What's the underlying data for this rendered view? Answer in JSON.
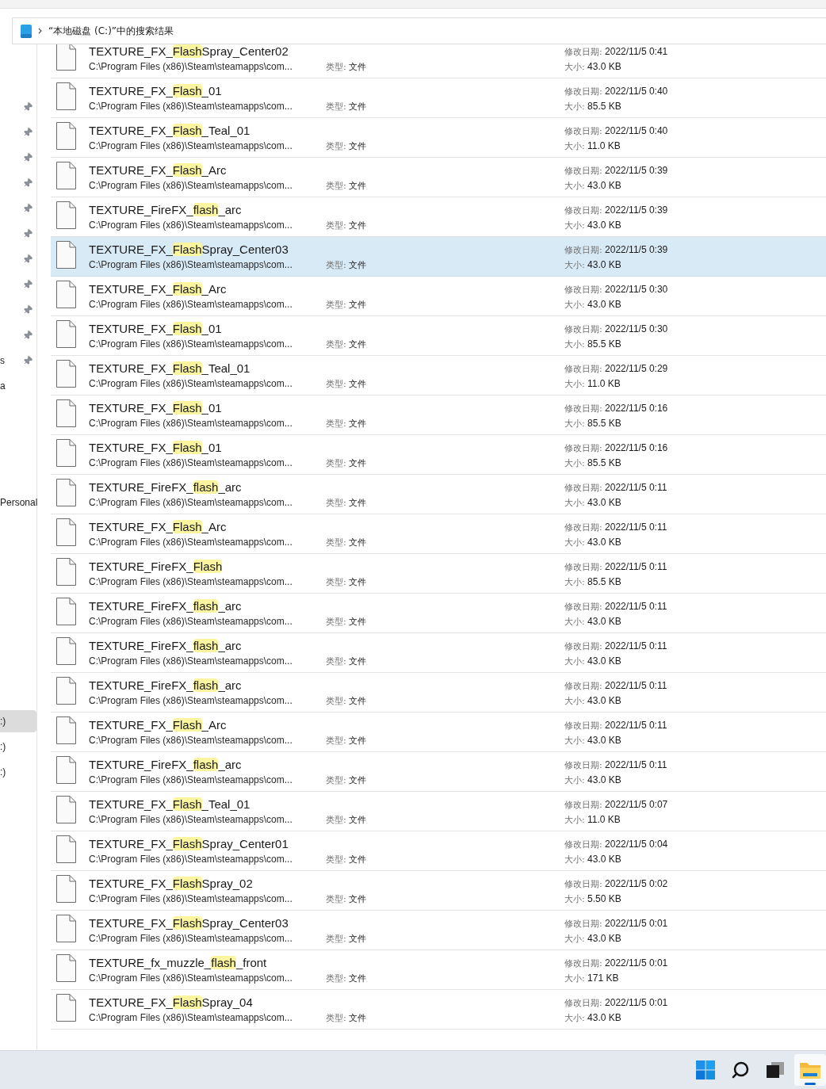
{
  "address_bar": {
    "path": "“本地磁盘 (C:)”中的搜索结果"
  },
  "sidebar": {
    "groups": [
      {
        "items": [
          {
            "pinned": true,
            "selected": false
          },
          {
            "pinned": true,
            "selected": false
          },
          {
            "pinned": true,
            "selected": false
          },
          {
            "pinned": true,
            "selected": false
          },
          {
            "pinned": true,
            "selected": false
          },
          {
            "pinned": true,
            "selected": false
          },
          {
            "pinned": true,
            "selected": false
          },
          {
            "pinned": true,
            "selected": false
          },
          {
            "pinned": true,
            "selected": false
          },
          {
            "pinned": true,
            "selected": false
          },
          {
            "label": "s",
            "pinned": true,
            "selected": false
          },
          {
            "label": "a",
            "pinned": false,
            "selected": false
          }
        ]
      },
      {
        "items": [
          {
            "label": "Personal",
            "pinned": false,
            "selected": false
          }
        ]
      },
      {
        "items": [
          {
            "label": ":)",
            "pinned": false,
            "selected": true
          },
          {
            "label": ":)",
            "pinned": false,
            "selected": false
          },
          {
            "label": ":)",
            "pinned": false,
            "selected": false
          }
        ]
      }
    ]
  },
  "results": [
    {
      "name": {
        "pre": "TEXTURE_FX_",
        "match": "Flash",
        "post": "Spray_Center02"
      },
      "path": "C:\\Program Files (x86)\\Steam\\steamapps\\com...",
      "type_label": "类型:",
      "type": "文件",
      "date_label": "修改日期:",
      "date": "2022/11/5 0:41",
      "size_label": "大小:",
      "size": "43.0 KB",
      "selected": false
    },
    {
      "name": {
        "pre": "TEXTURE_FX_",
        "match": "Flash",
        "post": "_01"
      },
      "path": "C:\\Program Files (x86)\\Steam\\steamapps\\com...",
      "type_label": "类型:",
      "type": "文件",
      "date_label": "修改日期:",
      "date": "2022/11/5 0:40",
      "size_label": "大小:",
      "size": "85.5 KB",
      "selected": false
    },
    {
      "name": {
        "pre": "TEXTURE_FX_",
        "match": "Flash",
        "post": "_Teal_01"
      },
      "path": "C:\\Program Files (x86)\\Steam\\steamapps\\com...",
      "type_label": "类型:",
      "type": "文件",
      "date_label": "修改日期:",
      "date": "2022/11/5 0:40",
      "size_label": "大小:",
      "size": "11.0 KB",
      "selected": false
    },
    {
      "name": {
        "pre": "TEXTURE_FX_",
        "match": "Flash",
        "post": "_Arc"
      },
      "path": "C:\\Program Files (x86)\\Steam\\steamapps\\com...",
      "type_label": "类型:",
      "type": "文件",
      "date_label": "修改日期:",
      "date": "2022/11/5 0:39",
      "size_label": "大小:",
      "size": "43.0 KB",
      "selected": false
    },
    {
      "name": {
        "pre": "TEXTURE_FireFX_",
        "match": "flash",
        "post": "_arc"
      },
      "path": "C:\\Program Files (x86)\\Steam\\steamapps\\com...",
      "type_label": "类型:",
      "type": "文件",
      "date_label": "修改日期:",
      "date": "2022/11/5 0:39",
      "size_label": "大小:",
      "size": "43.0 KB",
      "selected": false
    },
    {
      "name": {
        "pre": "TEXTURE_FX_",
        "match": "Flash",
        "post": "Spray_Center03"
      },
      "path": "C:\\Program Files (x86)\\Steam\\steamapps\\com...",
      "type_label": "类型:",
      "type": "文件",
      "date_label": "修改日期:",
      "date": "2022/11/5 0:39",
      "size_label": "大小:",
      "size": "43.0 KB",
      "selected": true
    },
    {
      "name": {
        "pre": "TEXTURE_FX_",
        "match": "Flash",
        "post": "_Arc"
      },
      "path": "C:\\Program Files (x86)\\Steam\\steamapps\\com...",
      "type_label": "类型:",
      "type": "文件",
      "date_label": "修改日期:",
      "date": "2022/11/5 0:30",
      "size_label": "大小:",
      "size": "43.0 KB",
      "selected": false
    },
    {
      "name": {
        "pre": "TEXTURE_FX_",
        "match": "Flash",
        "post": "_01"
      },
      "path": "C:\\Program Files (x86)\\Steam\\steamapps\\com...",
      "type_label": "类型:",
      "type": "文件",
      "date_label": "修改日期:",
      "date": "2022/11/5 0:30",
      "size_label": "大小:",
      "size": "85.5 KB",
      "selected": false
    },
    {
      "name": {
        "pre": "TEXTURE_FX_",
        "match": "Flash",
        "post": "_Teal_01"
      },
      "path": "C:\\Program Files (x86)\\Steam\\steamapps\\com...",
      "type_label": "类型:",
      "type": "文件",
      "date_label": "修改日期:",
      "date": "2022/11/5 0:29",
      "size_label": "大小:",
      "size": "11.0 KB",
      "selected": false
    },
    {
      "name": {
        "pre": "TEXTURE_FX_",
        "match": "Flash",
        "post": "_01"
      },
      "path": "C:\\Program Files (x86)\\Steam\\steamapps\\com...",
      "type_label": "类型:",
      "type": "文件",
      "date_label": "修改日期:",
      "date": "2022/11/5 0:16",
      "size_label": "大小:",
      "size": "85.5 KB",
      "selected": false
    },
    {
      "name": {
        "pre": "TEXTURE_FX_",
        "match": "Flash",
        "post": "_01"
      },
      "path": "C:\\Program Files (x86)\\Steam\\steamapps\\com...",
      "type_label": "类型:",
      "type": "文件",
      "date_label": "修改日期:",
      "date": "2022/11/5 0:16",
      "size_label": "大小:",
      "size": "85.5 KB",
      "selected": false
    },
    {
      "name": {
        "pre": "TEXTURE_FireFX_",
        "match": "flash",
        "post": "_arc"
      },
      "path": "C:\\Program Files (x86)\\Steam\\steamapps\\com...",
      "type_label": "类型:",
      "type": "文件",
      "date_label": "修改日期:",
      "date": "2022/11/5 0:11",
      "size_label": "大小:",
      "size": "43.0 KB",
      "selected": false
    },
    {
      "name": {
        "pre": "TEXTURE_FX_",
        "match": "Flash",
        "post": "_Arc"
      },
      "path": "C:\\Program Files (x86)\\Steam\\steamapps\\com...",
      "type_label": "类型:",
      "type": "文件",
      "date_label": "修改日期:",
      "date": "2022/11/5 0:11",
      "size_label": "大小:",
      "size": "43.0 KB",
      "selected": false
    },
    {
      "name": {
        "pre": "TEXTURE_FireFX_",
        "match": "Flash"
      },
      "path": "C:\\Program Files (x86)\\Steam\\steamapps\\com...",
      "type_label": "类型:",
      "type": "文件",
      "date_label": "修改日期:",
      "date": "2022/11/5 0:11",
      "size_label": "大小:",
      "size": "85.5 KB",
      "selected": false
    },
    {
      "name": {
        "pre": "TEXTURE_FireFX_",
        "match": "flash",
        "post": "_arc"
      },
      "path": "C:\\Program Files (x86)\\Steam\\steamapps\\com...",
      "type_label": "类型:",
      "type": "文件",
      "date_label": "修改日期:",
      "date": "2022/11/5 0:11",
      "size_label": "大小:",
      "size": "43.0 KB",
      "selected": false
    },
    {
      "name": {
        "pre": "TEXTURE_FireFX_",
        "match": "flash",
        "post": "_arc"
      },
      "path": "C:\\Program Files (x86)\\Steam\\steamapps\\com...",
      "type_label": "类型:",
      "type": "文件",
      "date_label": "修改日期:",
      "date": "2022/11/5 0:11",
      "size_label": "大小:",
      "size": "43.0 KB",
      "selected": false
    },
    {
      "name": {
        "pre": "TEXTURE_FireFX_",
        "match": "flash",
        "post": "_arc"
      },
      "path": "C:\\Program Files (x86)\\Steam\\steamapps\\com...",
      "type_label": "类型:",
      "type": "文件",
      "date_label": "修改日期:",
      "date": "2022/11/5 0:11",
      "size_label": "大小:",
      "size": "43.0 KB",
      "selected": false
    },
    {
      "name": {
        "pre": "TEXTURE_FX_",
        "match": "Flash",
        "post": "_Arc"
      },
      "path": "C:\\Program Files (x86)\\Steam\\steamapps\\com...",
      "type_label": "类型:",
      "type": "文件",
      "date_label": "修改日期:",
      "date": "2022/11/5 0:11",
      "size_label": "大小:",
      "size": "43.0 KB",
      "selected": false
    },
    {
      "name": {
        "pre": "TEXTURE_FireFX_",
        "match": "flash",
        "post": "_arc"
      },
      "path": "C:\\Program Files (x86)\\Steam\\steamapps\\com...",
      "type_label": "类型:",
      "type": "文件",
      "date_label": "修改日期:",
      "date": "2022/11/5 0:11",
      "size_label": "大小:",
      "size": "43.0 KB",
      "selected": false
    },
    {
      "name": {
        "pre": "TEXTURE_FX_",
        "match": "Flash",
        "post": "_Teal_01"
      },
      "path": "C:\\Program Files (x86)\\Steam\\steamapps\\com...",
      "type_label": "类型:",
      "type": "文件",
      "date_label": "修改日期:",
      "date": "2022/11/5 0:07",
      "size_label": "大小:",
      "size": "11.0 KB",
      "selected": false
    },
    {
      "name": {
        "pre": "TEXTURE_FX_",
        "match": "Flash",
        "post": "Spray_Center01"
      },
      "path": "C:\\Program Files (x86)\\Steam\\steamapps\\com...",
      "type_label": "类型:",
      "type": "文件",
      "date_label": "修改日期:",
      "date": "2022/11/5 0:04",
      "size_label": "大小:",
      "size": "43.0 KB",
      "selected": false
    },
    {
      "name": {
        "pre": "TEXTURE_FX_",
        "match": "Flash",
        "post": "Spray_02"
      },
      "path": "C:\\Program Files (x86)\\Steam\\steamapps\\com...",
      "type_label": "类型:",
      "type": "文件",
      "date_label": "修改日期:",
      "date": "2022/11/5 0:02",
      "size_label": "大小:",
      "size": "5.50 KB",
      "selected": false
    },
    {
      "name": {
        "pre": "TEXTURE_FX_",
        "match": "Flash",
        "post": "Spray_Center03"
      },
      "path": "C:\\Program Files (x86)\\Steam\\steamapps\\com...",
      "type_label": "类型:",
      "type": "文件",
      "date_label": "修改日期:",
      "date": "2022/11/5 0:01",
      "size_label": "大小:",
      "size": "43.0 KB",
      "selected": false
    },
    {
      "name": {
        "pre": "TEXTURE_fx_muzzle_",
        "match": "flash",
        "post": "_front"
      },
      "path": "C:\\Program Files (x86)\\Steam\\steamapps\\com...",
      "type_label": "类型:",
      "type": "文件",
      "date_label": "修改日期:",
      "date": "2022/11/5 0:01",
      "size_label": "大小:",
      "size": "171 KB",
      "selected": false
    },
    {
      "name": {
        "pre": "TEXTURE_FX_",
        "match": "Flash",
        "post": "Spray_04"
      },
      "path": "C:\\Program Files (x86)\\Steam\\steamapps\\com...",
      "type_label": "类型:",
      "type": "文件",
      "date_label": "修改日期:",
      "date": "2022/11/5 0:01",
      "size_label": "大小:",
      "size": "43.0 KB",
      "selected": false
    }
  ],
  "taskbar": {
    "items": [
      {
        "kind": "start",
        "active": false
      },
      {
        "kind": "search",
        "active": false
      },
      {
        "kind": "taskview",
        "active": false
      },
      {
        "kind": "explorer",
        "active": true
      }
    ]
  }
}
